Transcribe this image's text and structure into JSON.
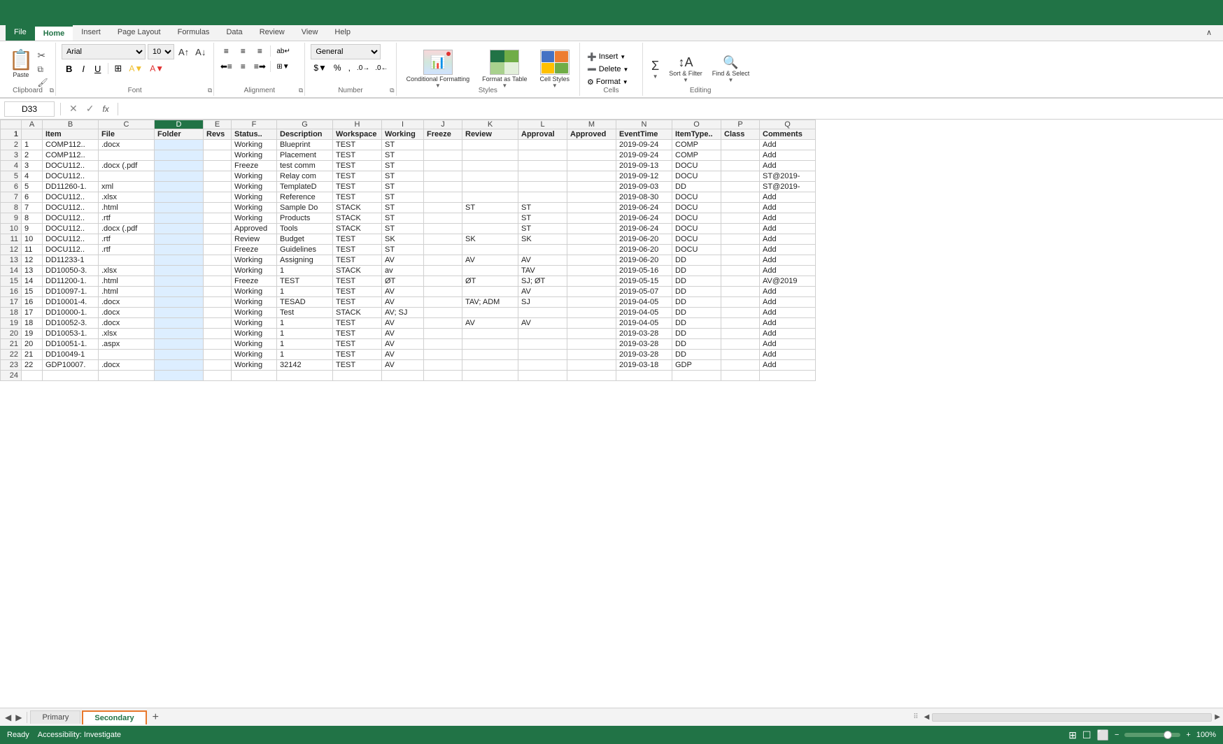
{
  "titleBar": {
    "color": "#217346"
  },
  "ribbon": {
    "tabs": [
      "File",
      "Home",
      "Insert",
      "Page Layout",
      "Formulas",
      "Data",
      "Review",
      "View",
      "Help"
    ],
    "activeTab": "Home",
    "groups": {
      "clipboard": {
        "label": "Clipboard"
      },
      "font": {
        "label": "Font",
        "fontName": "Arial",
        "fontSize": "10",
        "bold": "B",
        "italic": "I",
        "underline": "U"
      },
      "alignment": {
        "label": "Alignment"
      },
      "number": {
        "label": "Number",
        "format": "General"
      },
      "styles": {
        "label": "Styles",
        "conditionalFormatting": "Conditional Formatting",
        "formatAsTable": "Format as Table",
        "cellStyles": "Cell Styles"
      },
      "cells": {
        "label": "Cells",
        "insert": "Insert",
        "delete": "Delete",
        "format": "Format"
      },
      "editing": {
        "label": "Editing",
        "sortFilter": "Sort & Filter",
        "findSelect": "Find & Select"
      }
    }
  },
  "formulaBar": {
    "cellRef": "D33",
    "formula": ""
  },
  "columns": {
    "headers": [
      "",
      "A",
      "B",
      "C",
      "D",
      "E",
      "F",
      "G",
      "H",
      "I",
      "J",
      "K",
      "L",
      "M",
      "N",
      "O",
      "P",
      "Q"
    ]
  },
  "rows": [
    {
      "num": "1",
      "cells": [
        "",
        "Item",
        "File",
        "Folder",
        "Revs",
        "Status..",
        "Description",
        "Workspace",
        "Working",
        "Freeze",
        "Review",
        "Approval",
        "Approved",
        "EventTime",
        "ItemType..",
        "Class",
        "Comments"
      ]
    },
    {
      "num": "2",
      "cells": [
        "1",
        "COMP112..",
        ".docx",
        "",
        "",
        "Working",
        "Blueprint",
        "TEST",
        "ST",
        "",
        "",
        "",
        "",
        "2019-09-24",
        "COMP",
        "",
        "Add"
      ]
    },
    {
      "num": "3",
      "cells": [
        "2",
        "COMP112..",
        "",
        "",
        "",
        "Working",
        "Placement",
        "TEST",
        "ST",
        "",
        "",
        "",
        "",
        "2019-09-24",
        "COMP",
        "",
        "Add"
      ]
    },
    {
      "num": "4",
      "cells": [
        "3",
        "DOCU112..",
        ".docx (.pdf",
        "",
        "",
        "Freeze",
        "test comm",
        "TEST",
        "ST",
        "",
        "",
        "",
        "",
        "2019-09-13",
        "DOCU",
        "",
        "Add"
      ]
    },
    {
      "num": "5",
      "cells": [
        "4",
        "DOCU112..",
        "",
        "",
        "",
        "Working",
        "Relay com",
        "TEST",
        "ST",
        "",
        "",
        "",
        "",
        "2019-09-12",
        "DOCU",
        "",
        "ST@2019-"
      ]
    },
    {
      "num": "6",
      "cells": [
        "5",
        "DD11260-1.",
        "xml",
        "",
        "",
        "Working",
        "TemplateD",
        "TEST",
        "ST",
        "",
        "",
        "",
        "",
        "2019-09-03",
        "DD",
        "",
        "ST@2019-"
      ]
    },
    {
      "num": "7",
      "cells": [
        "6",
        "DOCU112..",
        ".xlsx",
        "",
        "",
        "Working",
        "Reference",
        "TEST",
        "ST",
        "",
        "",
        "",
        "",
        "2019-08-30",
        "DOCU",
        "",
        "Add"
      ]
    },
    {
      "num": "8",
      "cells": [
        "7",
        "DOCU112..",
        ".html",
        "",
        "",
        "Working",
        "Sample Do",
        "STACK",
        "ST",
        "",
        "ST",
        "ST",
        "",
        "2019-06-24",
        "DOCU",
        "",
        "Add"
      ]
    },
    {
      "num": "9",
      "cells": [
        "8",
        "DOCU112..",
        ".rtf",
        "",
        "",
        "Working",
        "Products",
        "STACK",
        "ST",
        "",
        "",
        "ST",
        "",
        "2019-06-24",
        "DOCU",
        "",
        "Add"
      ]
    },
    {
      "num": "10",
      "cells": [
        "9",
        "DOCU112..",
        ".docx (.pdf",
        "",
        "",
        "Approved",
        "Tools",
        "STACK",
        "ST",
        "",
        "",
        "ST",
        "",
        "2019-06-24",
        "DOCU",
        "",
        "Add"
      ]
    },
    {
      "num": "11",
      "cells": [
        "10",
        "DOCU112..",
        ".rtf",
        "",
        "",
        "Review",
        "Budget",
        "TEST",
        "SK",
        "",
        "SK",
        "SK",
        "",
        "2019-06-20",
        "DOCU",
        "",
        "Add"
      ]
    },
    {
      "num": "12",
      "cells": [
        "11",
        "DOCU112..",
        ".rtf",
        "",
        "",
        "Freeze",
        "Guidelines",
        "TEST",
        "ST",
        "",
        "",
        "",
        "",
        "2019-06-20",
        "DOCU",
        "",
        "Add"
      ]
    },
    {
      "num": "13",
      "cells": [
        "12",
        "DD11233-1",
        "",
        "",
        "",
        "Working",
        "Assigning",
        "TEST",
        "AV",
        "",
        "AV",
        "AV",
        "",
        "2019-06-20",
        "DD",
        "",
        "Add"
      ]
    },
    {
      "num": "14",
      "cells": [
        "13",
        "DD10050-3.",
        ".xlsx",
        "",
        "",
        "Working",
        "1",
        "STACK",
        "av",
        "",
        "",
        "TAV",
        "",
        "2019-05-16",
        "DD",
        "",
        "Add"
      ]
    },
    {
      "num": "15",
      "cells": [
        "14",
        "DD11200-1.",
        ".html",
        "",
        "",
        "Freeze",
        "TEST",
        "TEST",
        "ØT",
        "",
        "ØT",
        "SJ; ØT",
        "",
        "2019-05-15",
        "DD",
        "",
        "AV@2019"
      ]
    },
    {
      "num": "16",
      "cells": [
        "15",
        "DD10097-1.",
        ".html",
        "",
        "",
        "Working",
        "1",
        "TEST",
        "AV",
        "",
        "",
        "AV",
        "",
        "2019-05-07",
        "DD",
        "",
        "Add"
      ]
    },
    {
      "num": "17",
      "cells": [
        "16",
        "DD10001-4.",
        ".docx",
        "",
        "",
        "Working",
        "TESAD",
        "TEST",
        "AV",
        "",
        "TAV; ADM",
        "SJ",
        "",
        "2019-04-05",
        "DD",
        "",
        "Add"
      ]
    },
    {
      "num": "18",
      "cells": [
        "17",
        "DD10000-1.",
        ".docx",
        "",
        "",
        "Working",
        "Test",
        "STACK",
        "AV; SJ",
        "",
        "",
        "",
        "",
        "2019-04-05",
        "DD",
        "",
        "Add"
      ]
    },
    {
      "num": "19",
      "cells": [
        "18",
        "DD10052-3.",
        ".docx",
        "",
        "",
        "Working",
        "1",
        "TEST",
        "AV",
        "",
        "AV",
        "AV",
        "",
        "2019-04-05",
        "DD",
        "",
        "Add"
      ]
    },
    {
      "num": "20",
      "cells": [
        "19",
        "DD10053-1.",
        ".xlsx",
        "",
        "",
        "Working",
        "1",
        "TEST",
        "AV",
        "",
        "",
        "",
        "",
        "2019-03-28",
        "DD",
        "",
        "Add"
      ]
    },
    {
      "num": "21",
      "cells": [
        "20",
        "DD10051-1.",
        ".aspx",
        "",
        "",
        "Working",
        "1",
        "TEST",
        "AV",
        "",
        "",
        "",
        "",
        "2019-03-28",
        "DD",
        "",
        "Add"
      ]
    },
    {
      "num": "22",
      "cells": [
        "21",
        "DD10049-1",
        "",
        "",
        "",
        "Working",
        "1",
        "TEST",
        "AV",
        "",
        "",
        "",
        "",
        "2019-03-28",
        "DD",
        "",
        "Add"
      ]
    },
    {
      "num": "23",
      "cells": [
        "22",
        "GDP10007.",
        ".docx",
        "",
        "",
        "Working",
        "32142",
        "TEST",
        "AV",
        "",
        "",
        "",
        "",
        "2019-03-18",
        "GDP",
        "",
        "Add"
      ]
    },
    {
      "num": "24",
      "cells": [
        "",
        "",
        "",
        "",
        "",
        "",
        "",
        "",
        "",
        "",
        "",
        "",
        "",
        "",
        "",
        "",
        ""
      ]
    }
  ],
  "sheetTabs": {
    "tabs": [
      "Primary",
      "Secondary"
    ],
    "activeTab": "Secondary",
    "addLabel": "+"
  },
  "statusBar": {
    "viewIcons": [
      "⊞",
      "☐",
      "⬜"
    ],
    "zoom": "100%",
    "zoomMinus": "−",
    "zoomPlus": "+"
  }
}
